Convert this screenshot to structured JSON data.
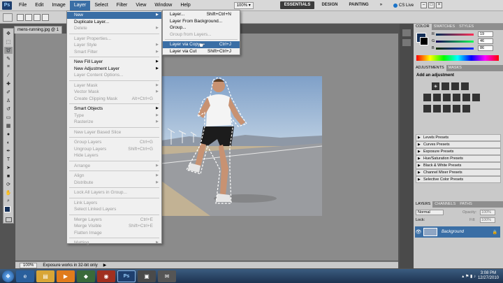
{
  "app": {
    "logo_text": "Ps"
  },
  "menubar": {
    "items": [
      "File",
      "Edit",
      "Image",
      "Layer",
      "Select",
      "Filter",
      "View",
      "Window",
      "Help"
    ],
    "active": "Layer",
    "zoom": "100%",
    "workspaces": [
      "ESSENTIALS",
      "DESIGN",
      "PAINTING"
    ],
    "workspace_more": "»",
    "cslive": "CS Live"
  },
  "document": {
    "tab_label": "mens-running.jpg @ 1",
    "tab_close": "×"
  },
  "status": {
    "zoom": "100%",
    "message": "Exposure works in 32-bit only"
  },
  "layer_menu": [
    {
      "label": "New",
      "sub": true,
      "hl": true
    },
    {
      "label": "Duplicate Layer..."
    },
    {
      "label": "Delete",
      "sub": true,
      "dis": true
    },
    {
      "sep": true
    },
    {
      "label": "Layer Properties...",
      "dis": true
    },
    {
      "label": "Layer Style",
      "sub": true,
      "dis": true
    },
    {
      "label": "Smart Filter",
      "sub": true,
      "dis": true
    },
    {
      "sep": true
    },
    {
      "label": "New Fill Layer",
      "sub": true
    },
    {
      "label": "New Adjustment Layer",
      "sub": true
    },
    {
      "label": "Layer Content Options...",
      "dis": true
    },
    {
      "sep": true
    },
    {
      "label": "Layer Mask",
      "sub": true,
      "dis": true
    },
    {
      "label": "Vector Mask",
      "sub": true,
      "dis": true
    },
    {
      "label": "Create Clipping Mask",
      "shortcut": "Alt+Ctrl+G",
      "dis": true
    },
    {
      "sep": true
    },
    {
      "label": "Smart Objects",
      "sub": true
    },
    {
      "label": "Type",
      "sub": true,
      "dis": true
    },
    {
      "label": "Rasterize",
      "sub": true,
      "dis": true
    },
    {
      "sep": true
    },
    {
      "label": "New Layer Based Slice",
      "dis": true
    },
    {
      "sep": true
    },
    {
      "label": "Group Layers",
      "shortcut": "Ctrl+G",
      "dis": true
    },
    {
      "label": "Ungroup Layers",
      "shortcut": "Shift+Ctrl+G",
      "dis": true
    },
    {
      "label": "Hide Layers",
      "dis": true
    },
    {
      "sep": true
    },
    {
      "label": "Arrange",
      "sub": true,
      "dis": true
    },
    {
      "sep": true
    },
    {
      "label": "Align",
      "sub": true,
      "dis": true
    },
    {
      "label": "Distribute",
      "sub": true,
      "dis": true
    },
    {
      "sep": true
    },
    {
      "label": "Lock All Layers in Group...",
      "dis": true
    },
    {
      "sep": true
    },
    {
      "label": "Link Layers",
      "dis": true
    },
    {
      "label": "Select Linked Layers",
      "dis": true
    },
    {
      "sep": true
    },
    {
      "label": "Merge Layers",
      "shortcut": "Ctrl+E",
      "dis": true
    },
    {
      "label": "Merge Visible",
      "shortcut": "Shift+Ctrl+E",
      "dis": true
    },
    {
      "label": "Flatten Image",
      "dis": true
    },
    {
      "sep": true
    },
    {
      "label": "Matting",
      "sub": true,
      "dis": true
    }
  ],
  "new_submenu": [
    {
      "label": "Layer...",
      "shortcut": "Shift+Ctrl+N"
    },
    {
      "label": "Layer From Background..."
    },
    {
      "label": "Group..."
    },
    {
      "label": "Group from Layers...",
      "dis": true
    },
    {
      "sep": true
    },
    {
      "label": "Layer via Copy",
      "shortcut": "Ctrl+J",
      "hl": true
    },
    {
      "label": "Layer via Cut",
      "shortcut": "Shift+Ctrl+J"
    }
  ],
  "color_panel": {
    "tabs": [
      "COLOR",
      "SWATCHES",
      "STYLES"
    ],
    "r": "19",
    "g": "46",
    "b": "86",
    "r_label": "R",
    "g_label": "G",
    "b_label": "B",
    "fg_color": "#132e56"
  },
  "adjustments_panel": {
    "tabs": [
      "ADJUSTMENTS",
      "MASKS"
    ],
    "heading": "Add an adjustment",
    "presets": [
      "Levels Presets",
      "Curves Presets",
      "Exposure Presets",
      "Hue/Saturation Presets",
      "Black & White Presets",
      "Channel Mixer Presets",
      "Selective Color Presets"
    ]
  },
  "layers_panel": {
    "tabs": [
      "LAYERS",
      "CHANNELS",
      "PATHS"
    ],
    "blend_mode": "Normal",
    "opacity_label": "Opacity:",
    "opacity": "100%",
    "lock_label": "Lock:",
    "fill_label": "Fill:",
    "fill": "100%",
    "layer_name": "Background"
  },
  "taskbar": {
    "time": "3:08 PM",
    "date": "12/27/2010",
    "ps_label": "Ps"
  }
}
